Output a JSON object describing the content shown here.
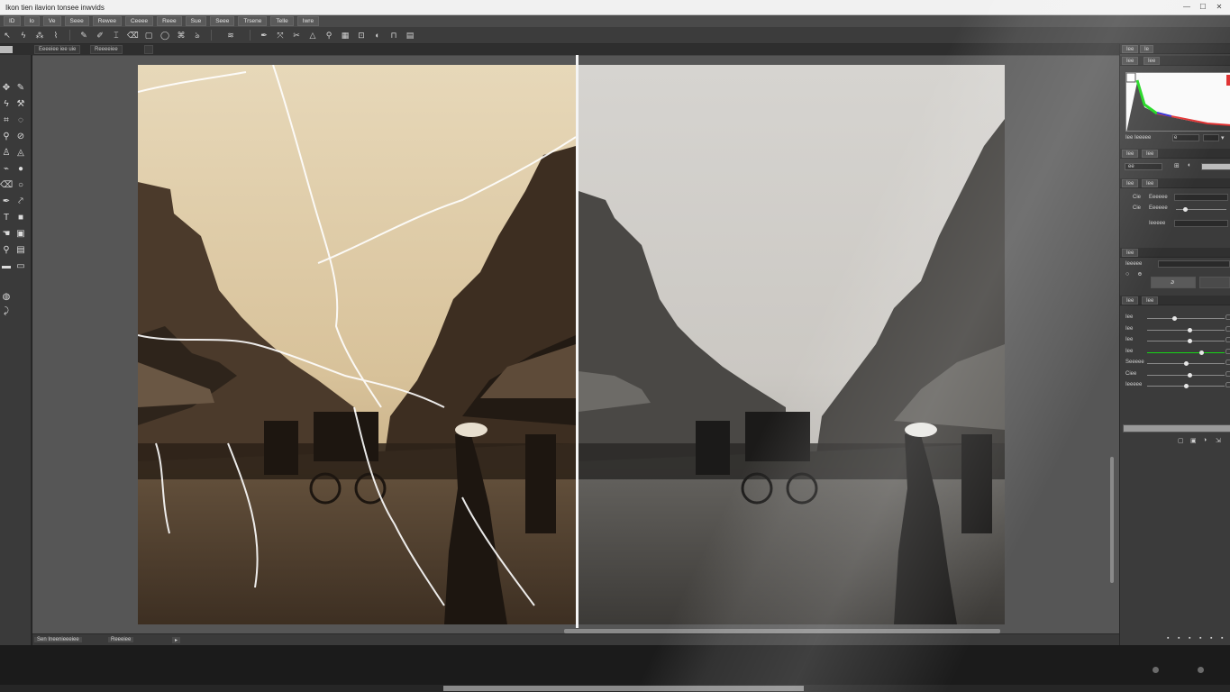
{
  "app": {
    "title": "Ikon tien ilavion tonsee inwvids",
    "window_buttons": [
      "—",
      "☐",
      "✕"
    ]
  },
  "menu": [
    "ID",
    "Io",
    "Ve",
    "Seee",
    "Rewee",
    "Ceeee",
    "Reee",
    "Sue",
    "Seee",
    "Trsene",
    "Telle",
    "Iwre"
  ],
  "documents": [
    "Eeeeiee iee uie",
    "Reeeeiee"
  ],
  "status": {
    "left": "Sen Ineenieeeiee",
    "right": "Reeeiee"
  },
  "panel": {
    "top_tabs": [
      "Iee",
      "Ie"
    ],
    "histogram_tabs": [
      "Iee",
      "Iee"
    ],
    "histogram_footer": "Iee Ieeeee",
    "histogram_value": "e",
    "section_tabs_a": [
      "Iee",
      "Iee"
    ],
    "zoom_value": "ee",
    "section_tabs_b": [
      "Iee",
      "Iee"
    ],
    "controls_b": [
      {
        "label": "Cie",
        "value": "Eeeeee"
      },
      {
        "label": "Cie",
        "value": "Eeeeee"
      },
      {
        "label": "",
        "value": "Ieeeee"
      }
    ],
    "section_c_tab": "Iee",
    "section_c_field": "Ieeeee",
    "section_d_tabs": [
      "Iee",
      "Iee"
    ],
    "adjustments": [
      {
        "label": "Iee",
        "value": 0.35
      },
      {
        "label": "Iee",
        "value": 0.55
      },
      {
        "label": "Iee",
        "value": 0.55
      },
      {
        "label": "Iee",
        "value": 0.7
      },
      {
        "label": "Seeeee",
        "value": 0.5
      },
      {
        "label": "Ciee",
        "value": 0.55
      },
      {
        "label": "Ieeeee",
        "value": 0.5
      }
    ]
  },
  "colors": {
    "accent_green": "#16d616",
    "accent_red": "#e03030",
    "panel_bg": "#3b3b3b",
    "workspace_bg": "#565656"
  }
}
